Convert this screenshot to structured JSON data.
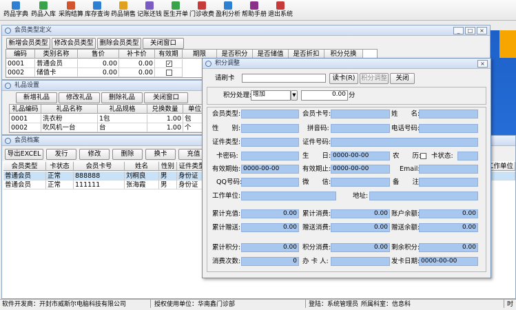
{
  "toolbar": {
    "items": [
      {
        "label": "药品字典",
        "icon": "dictionary-icon",
        "color": "#2d7fd1"
      },
      {
        "label": "药品入库",
        "icon": "stock-in-icon",
        "color": "#38a34b"
      },
      {
        "label": "采购结算",
        "icon": "purchase-settle-icon",
        "color": "#d2542e"
      },
      {
        "label": "库存查询",
        "icon": "inventory-query-icon",
        "color": "#2d7fd1"
      },
      {
        "label": "药品销售",
        "icon": "sales-icon",
        "color": "#e0a020"
      },
      {
        "label": "记账还钱",
        "icon": "ledger-icon",
        "color": "#7a5bc2"
      },
      {
        "label": "医生开单",
        "icon": "doctor-order-icon",
        "color": "#38a34b"
      },
      {
        "label": "门诊收费",
        "icon": "clinic-fee-icon",
        "color": "#c73a3a"
      },
      {
        "label": "盈利分析",
        "icon": "profit-chart-icon",
        "color": "#2d7fd1"
      },
      {
        "label": "帮助手册",
        "icon": "help-book-icon",
        "color": "#8a2f8a"
      },
      {
        "label": "退出系统",
        "icon": "exit-icon",
        "color": "#c73a3a"
      }
    ]
  },
  "member_type_window": {
    "title": "会员类型定义",
    "buttons": [
      "新增会员类型",
      "修改会员类型",
      "删除会员类型",
      "关闭窗口"
    ],
    "columns": [
      "编码",
      "类别名称",
      "售价",
      "补卡价",
      "有效期",
      "期限",
      "是否积分",
      "是否储值",
      "是否折扣",
      "积分兑换"
    ],
    "rows": [
      {
        "code": "0001",
        "name": "普通会员",
        "price": "0.00",
        "reissue": "0.00",
        "valid": "✓"
      },
      {
        "code": "0002",
        "name": "储值卡",
        "price": "0.00",
        "reissue": "0.00",
        "valid": ""
      }
    ]
  },
  "gift_window": {
    "title": "礼品设置",
    "buttons": [
      "新增礼品",
      "修改礼品",
      "删除礼品",
      "关闭窗口"
    ],
    "columns": [
      "礼品编码",
      "礼品名称",
      "礼品规格",
      "兑换数量",
      "单位"
    ],
    "rows": [
      {
        "code": "0001",
        "name": "洗衣粉",
        "spec": "1包",
        "qty": "1.00",
        "unit": "包"
      },
      {
        "code": "0002",
        "name": "吹风机一台",
        "spec": "台",
        "qty": "1.00",
        "unit": "个"
      }
    ]
  },
  "member_archive_window": {
    "title": "会员档案",
    "buttons": [
      "导出EXCEL",
      "发行",
      "修改",
      "删除",
      "换卡",
      "充值"
    ],
    "columns": [
      "会员类型",
      "卡状态",
      "会员卡号",
      "姓名",
      "性别",
      "证件类型"
    ],
    "extra_column": "工作单位",
    "rows": [
      {
        "type": "普通会员",
        "status": "正常",
        "card": "888888",
        "name": "刘桐良",
        "sex": "男",
        "idtype": "身份证"
      },
      {
        "type": "普通会员",
        "status": "正常",
        "card": "111111",
        "name": "张海霞",
        "sex": "男",
        "idtype": "身份证"
      }
    ]
  },
  "points_dialog": {
    "title": "积分调整",
    "swipe_label": "请刷卡",
    "swipe_value": "",
    "read_card_btn": "读卡(R)",
    "adjust_btn": "积分调整",
    "close_btn": "关闭",
    "process_label": "积分处理:",
    "process_value": "增加",
    "amount_value": "0.00",
    "amount_unit": "分",
    "labels": {
      "member_type": "会员类型:",
      "card_no": "会员卡号:",
      "name": "姓　　名:",
      "sex": "性　　别:",
      "pinyin": "拼音码:",
      "phone": "电话号码:",
      "id_type": "证件类型:",
      "id_no": "证件号码:",
      "card_pwd": "卡密码:",
      "birthday": "生　　日:",
      "lunar": "农　　历:",
      "card_status": "卡状态:",
      "valid_start": "有效期始:",
      "valid_end": "有效期止:",
      "email": "Email:",
      "qq": "QQ号码:",
      "wechat": "微　　信:",
      "remark": "备　　注:",
      "work_unit": "工作单位:",
      "address": "地址:",
      "total_recharge": "累计充值:",
      "total_consume": "累计消费:",
      "balance": "账户余额:",
      "total_gift": "累计赠送:",
      "gift_consume": "赠送消费:",
      "gift_balance": "赠送余额:",
      "total_points": "累计积分:",
      "points_consume": "积分消费:",
      "points_left": "剩余积分:",
      "consume_count": "消费次数:",
      "handler": "办 卡 人:",
      "issue_date": "发卡日期:"
    },
    "values": {
      "birthday": "0000-00-00",
      "valid_start": "0000-00-00",
      "valid_end": "0000-00-00",
      "total_recharge": "0.00",
      "total_consume": "0.00",
      "balance": "0.00",
      "total_gift": "0.00",
      "gift_consume": "0.00",
      "gift_balance": "0.00",
      "total_points": "0.00",
      "points_consume": "0.00",
      "points_left": "0.00",
      "consume_count": "0",
      "issue_date": "0000-00-00"
    }
  },
  "status": {
    "developer": "软件开发商：开封市威斯尔电脑科技有限公司",
    "licensee": "授权使用单位：华南鑫门诊部",
    "operator": "登陆：系统管理员",
    "dept": "所属科室：信息科",
    "time_label": "时"
  }
}
